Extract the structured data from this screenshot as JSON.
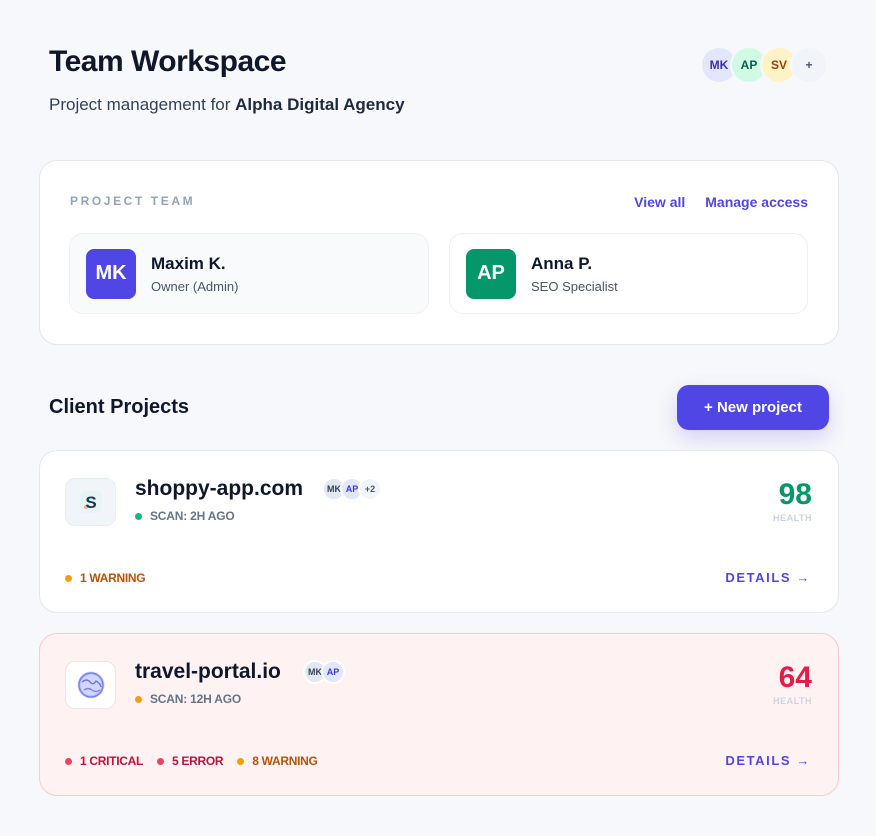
{
  "header": {
    "title": "Team Workspace",
    "subtitle_prefix": "Project management for ",
    "agency": "Alpha Digital Agency",
    "avatars": [
      {
        "initials": "MK",
        "bg": "#e0e7ff",
        "fg": "#3730a3"
      },
      {
        "initials": "AP",
        "bg": "#d1fae5",
        "fg": "#065f46"
      },
      {
        "initials": "SV",
        "bg": "#fef3c7",
        "fg": "#92400e"
      },
      {
        "initials": "+",
        "bg": "#f1f5f9",
        "fg": "#475569"
      }
    ]
  },
  "team": {
    "label": "PROJECT TEAM",
    "view_all": "View all",
    "manage_access": "Manage access",
    "members": [
      {
        "initials": "MK",
        "name": "Maxim K.",
        "role": "Owner (Admin)",
        "color": "#4f46e5"
      },
      {
        "initials": "AP",
        "name": "Anna P.",
        "role": "SEO Specialist",
        "color": "#059669"
      }
    ]
  },
  "projects_section": {
    "title": "Client Projects",
    "new_button": "+ New project"
  },
  "projects": [
    {
      "name": "shoppy-app.com",
      "logo": "S",
      "members": [
        "MK",
        "AP",
        "+2"
      ],
      "scan": "SCAN: 2H AGO",
      "scan_dot": "#10b981",
      "health": "98",
      "health_color": "#059669",
      "health_label": "HEALTH",
      "issues": [
        {
          "text": "1 WARNING",
          "color": "#b45309",
          "dot": "#f59e0b"
        }
      ],
      "details": "DETAILS →"
    },
    {
      "name": "travel-portal.io",
      "logo": "globe-icon",
      "members": [
        "MK",
        "AP"
      ],
      "scan": "SCAN: 12H AGO",
      "scan_dot": "#f59e0b",
      "health": "64",
      "health_color": "#e11d48",
      "health_label": "HEALTH",
      "issues": [
        {
          "text": "1 CRITICAL",
          "color": "#be123c",
          "dot": "#f43f5e"
        },
        {
          "text": "5 ERROR",
          "color": "#be123c",
          "dot": "#f43f5e"
        },
        {
          "text": "8 WARNING",
          "color": "#b45309",
          "dot": "#f59e0b"
        }
      ],
      "details": "DETAILS →"
    }
  ]
}
